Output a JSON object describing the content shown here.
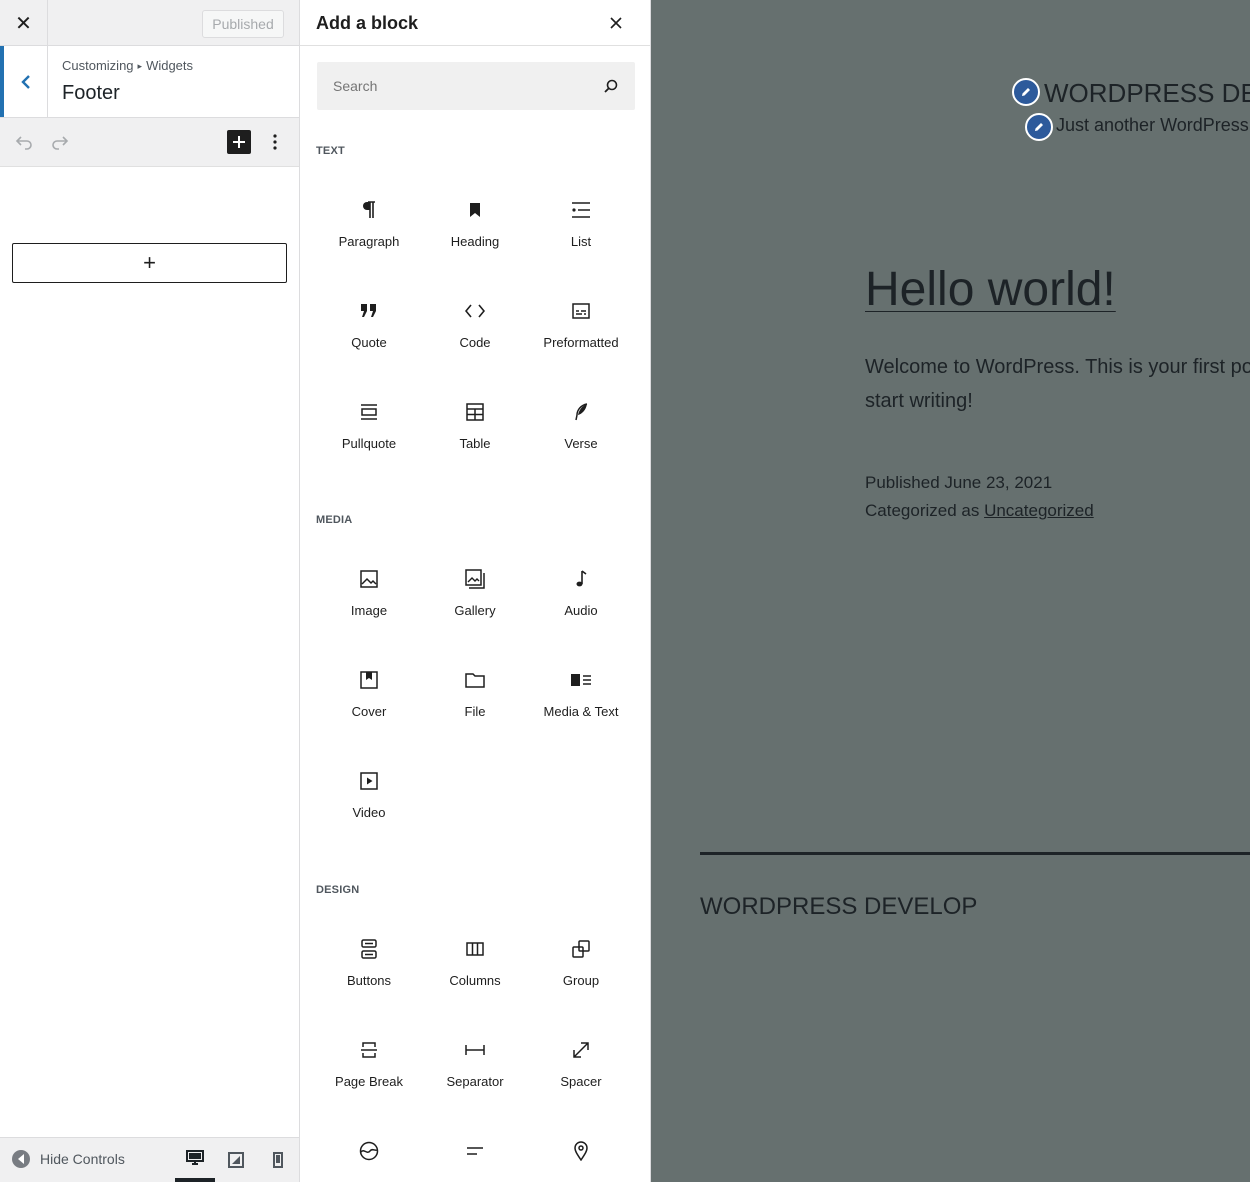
{
  "customizer": {
    "close_symbol": "✕",
    "publish_label": "Published",
    "breadcrumb_root": "Customizing",
    "breadcrumb_arrow": "▸",
    "breadcrumb_leaf": "Widgets",
    "section_title": "Footer",
    "hide_controls_label": "Hide Controls",
    "add_block_symbol": "+"
  },
  "inserter": {
    "title": "Add a block",
    "search_placeholder": "Search",
    "categories": [
      {
        "title": "Text",
        "blocks": [
          {
            "label": "Paragraph",
            "icon": "paragraph-icon"
          },
          {
            "label": "Heading",
            "icon": "bookmark-icon"
          },
          {
            "label": "List",
            "icon": "list-icon"
          },
          {
            "label": "Quote",
            "icon": "quote-icon"
          },
          {
            "label": "Code",
            "icon": "code-icon"
          },
          {
            "label": "Preformatted",
            "icon": "preformatted-icon"
          },
          {
            "label": "Pullquote",
            "icon": "pullquote-icon"
          },
          {
            "label": "Table",
            "icon": "table-icon"
          },
          {
            "label": "Verse",
            "icon": "quill-icon"
          }
        ]
      },
      {
        "title": "Media",
        "blocks": [
          {
            "label": "Image",
            "icon": "image-icon"
          },
          {
            "label": "Gallery",
            "icon": "gallery-icon"
          },
          {
            "label": "Audio",
            "icon": "music-note-icon"
          },
          {
            "label": "Cover",
            "icon": "cover-icon"
          },
          {
            "label": "File",
            "icon": "folder-icon"
          },
          {
            "label": "Media & Text",
            "icon": "media-text-icon"
          },
          {
            "label": "Video",
            "icon": "video-icon"
          }
        ]
      },
      {
        "title": "Design",
        "blocks": [
          {
            "label": "Buttons",
            "icon": "buttons-icon"
          },
          {
            "label": "Columns",
            "icon": "columns-icon"
          },
          {
            "label": "Group",
            "icon": "group-icon"
          },
          {
            "label": "Page Break",
            "icon": "page-break-icon"
          },
          {
            "label": "Separator",
            "icon": "separator-icon"
          },
          {
            "label": "Spacer",
            "icon": "resize-arrow-icon"
          },
          {
            "label": "",
            "icon": "wave-icon"
          },
          {
            "label": "",
            "icon": "more-icon"
          },
          {
            "label": "",
            "icon": "map-pin-icon"
          }
        ]
      }
    ]
  },
  "preview": {
    "site_title": "WORDPRESS DEVE",
    "tagline": "Just another WordPress",
    "post_title": "Hello world!",
    "post_body": "Welcome to WordPress. This is your first pos start writing!",
    "published_line": "Published June 23, 2021",
    "categorized_prefix": "Categorized as ",
    "category_link": "Uncategorized",
    "footer_site_title": "WORDPRESS DEVELOP",
    "background_color": "#66706f"
  },
  "colors": {
    "accent": "#2271b1",
    "dark": "#1e1e1e",
    "panel": "#f0f0f1"
  }
}
